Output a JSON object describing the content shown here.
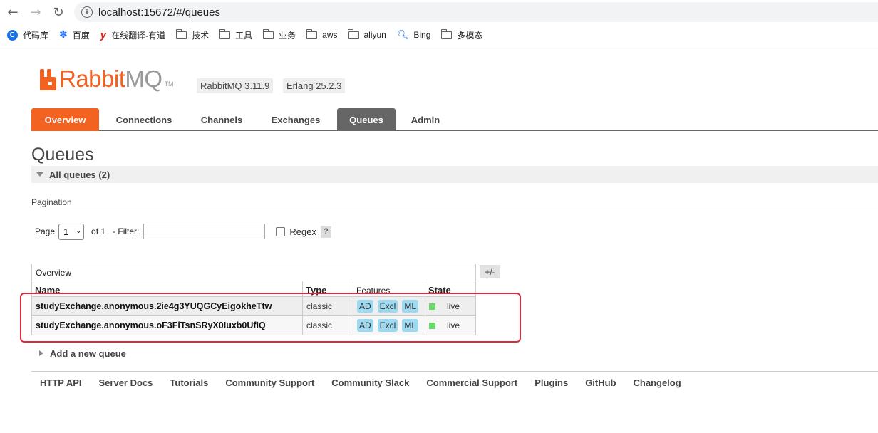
{
  "browser": {
    "url": "localhost:15672/#/queues",
    "bookmarks": [
      {
        "label": "代码库",
        "icon": "c-logo-icon"
      },
      {
        "label": "百度",
        "icon": "baidu-paw-icon"
      },
      {
        "label": "在线翻译-有道",
        "icon": "youdao-icon"
      },
      {
        "label": "技术",
        "icon": "folder-icon"
      },
      {
        "label": "工具",
        "icon": "folder-icon"
      },
      {
        "label": "业务",
        "icon": "folder-icon"
      },
      {
        "label": "aws",
        "icon": "folder-icon"
      },
      {
        "label": "aliyun",
        "icon": "folder-icon"
      },
      {
        "label": "Bing",
        "icon": "search-icon"
      },
      {
        "label": "多模态",
        "icon": "folder-icon"
      }
    ]
  },
  "app": {
    "logo_text_a": "Rabbit",
    "logo_text_b": "MQ",
    "logo_tm": "TM",
    "version": "RabbitMQ 3.11.9",
    "erlang": "Erlang 25.2.3",
    "brand_color": "#f26322"
  },
  "tabs": [
    "Overview",
    "Connections",
    "Channels",
    "Exchanges",
    "Queues",
    "Admin"
  ],
  "page": {
    "title": "Queues",
    "section": "All queues (2)",
    "pagination_label": "Pagination",
    "page_label": "Page",
    "page_value": "1",
    "of_label": "of 1",
    "filter_label": "- Filter:",
    "filter_value": "",
    "regex_label": "Regex",
    "help": "?"
  },
  "table": {
    "group_header": "Overview",
    "plus_minus": "+/-",
    "columns": [
      "Name",
      "Type",
      "Features",
      "State"
    ],
    "rows": [
      {
        "name": "studyExchange.anonymous.2ie4g3YUQGCyEigokheTtw",
        "type": "classic",
        "features": [
          "AD",
          "Excl",
          "ML"
        ],
        "state": "live"
      },
      {
        "name": "studyExchange.anonymous.oF3FiTsnSRyX0Iuxb0UfIQ",
        "type": "classic",
        "features": [
          "AD",
          "Excl",
          "ML"
        ],
        "state": "live"
      }
    ]
  },
  "add_queue": "Add a new queue",
  "footer": [
    "HTTP API",
    "Server Docs",
    "Tutorials",
    "Community Support",
    "Community Slack",
    "Commercial Support",
    "Plugins",
    "GitHub",
    "Changelog"
  ]
}
